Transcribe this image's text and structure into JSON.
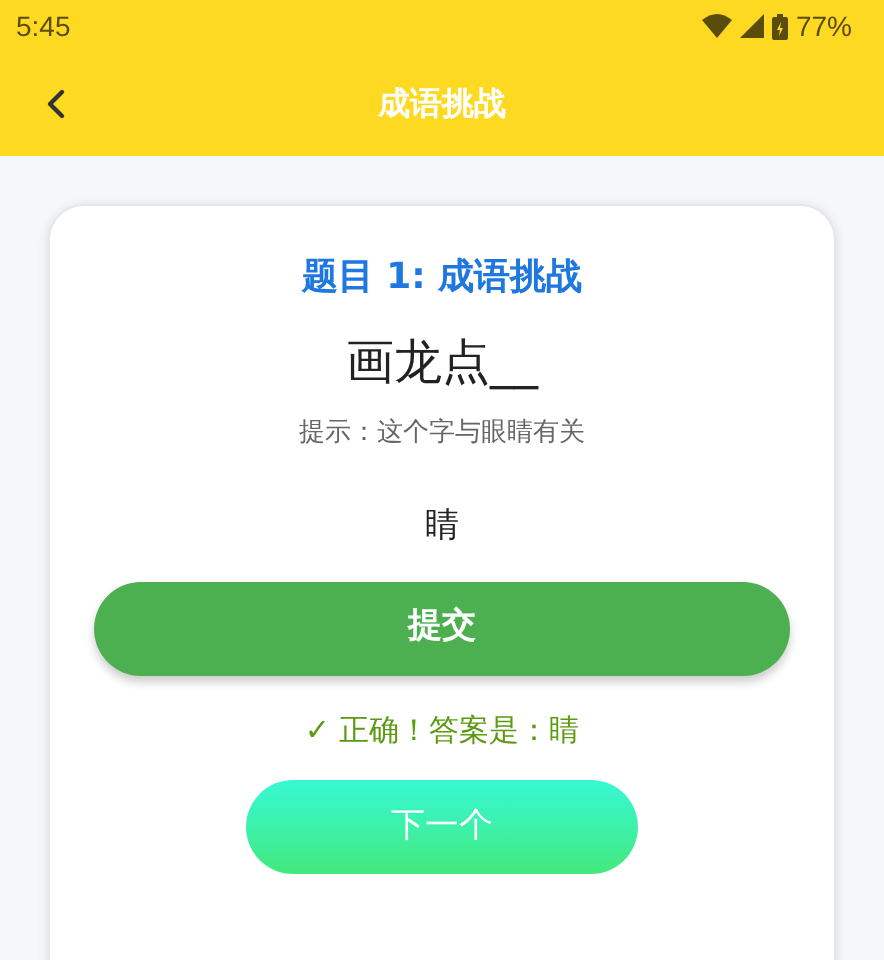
{
  "status_bar": {
    "time": "5:45",
    "battery": "77%"
  },
  "header": {
    "title": "成语挑战"
  },
  "question": {
    "title": "题目 1: 成语挑战",
    "puzzle": "画龙点__",
    "hint": "提示：这个字与眼睛有关",
    "answer": "睛"
  },
  "submit_button": "提交",
  "feedback": {
    "text": "✓ 正确！答案是：睛",
    "correct": true
  },
  "next_button": "下一个"
}
